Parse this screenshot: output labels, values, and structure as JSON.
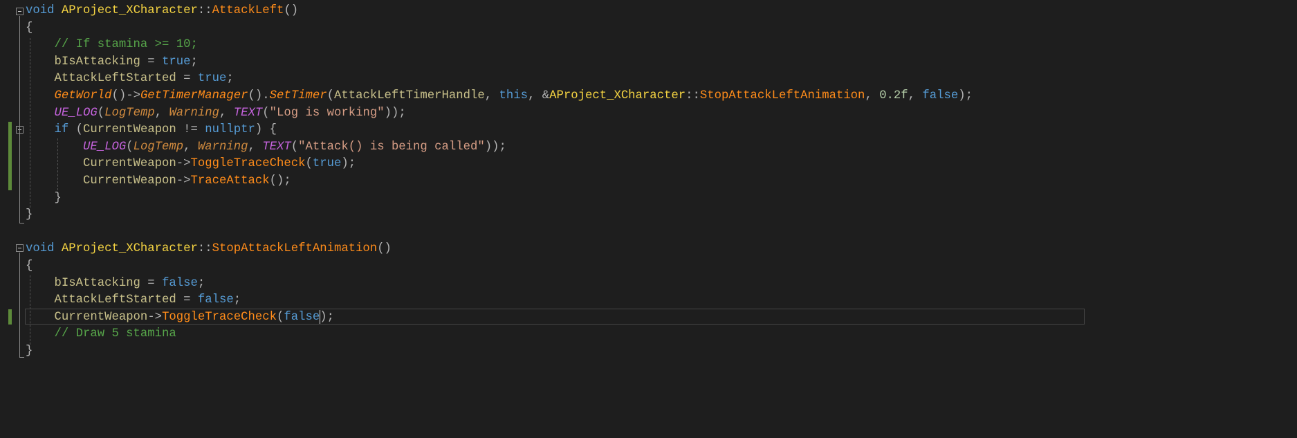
{
  "colors": {
    "background": "#1e1e1e",
    "keyword": "#569cd6",
    "class": "#f5d442",
    "function": "#ff8c1a",
    "variable": "#c8c08a",
    "comment": "#57a64a",
    "macro": "#c563dd",
    "string": "#d69d85",
    "change_marker": "#5d8a3a"
  },
  "lines": [
    {
      "t": [
        [
          "void",
          "kw"
        ],
        [
          " ",
          "p"
        ],
        [
          "AProject_XCharacter",
          "cls"
        ],
        [
          "::",
          "p"
        ],
        [
          "AttackLeft",
          "fn"
        ],
        [
          "()",
          "p"
        ]
      ]
    },
    {
      "t": [
        [
          "{",
          "p"
        ]
      ]
    },
    {
      "t": [
        [
          "    // If stamina >= 10;",
          "cm"
        ]
      ]
    },
    {
      "t": [
        [
          "    ",
          "p"
        ],
        [
          "bIsAttacking",
          "var"
        ],
        [
          " = ",
          "p"
        ],
        [
          "true",
          "kw"
        ],
        [
          ";",
          "p"
        ]
      ]
    },
    {
      "t": [
        [
          "    ",
          "p"
        ],
        [
          "AttackLeftStarted",
          "var"
        ],
        [
          " = ",
          "p"
        ],
        [
          "true",
          "kw"
        ],
        [
          ";",
          "p"
        ]
      ]
    },
    {
      "t": [
        [
          "    ",
          "p"
        ],
        [
          "GetWorld",
          "fni"
        ],
        [
          "()->",
          "p"
        ],
        [
          "GetTimerManager",
          "fni"
        ],
        [
          "().",
          "p"
        ],
        [
          "SetTimer",
          "fni"
        ],
        [
          "(",
          "p"
        ],
        [
          "AttackLeftTimerHandle",
          "var"
        ],
        [
          ", ",
          "p"
        ],
        [
          "this",
          "kw"
        ],
        [
          ", &",
          "p"
        ],
        [
          "AProject_XCharacter",
          "cls"
        ],
        [
          "::",
          "p"
        ],
        [
          "StopAttackLeftAnimation",
          "fn"
        ],
        [
          ", ",
          "p"
        ],
        [
          "0.2f",
          "num"
        ],
        [
          ", ",
          "p"
        ],
        [
          "false",
          "kw"
        ],
        [
          ");",
          "p"
        ]
      ]
    },
    {
      "t": [
        [
          "    ",
          "p"
        ],
        [
          "UE_LOG",
          "mac"
        ],
        [
          "(",
          "p"
        ],
        [
          "LogTemp",
          "mi"
        ],
        [
          ", ",
          "p"
        ],
        [
          "Warning",
          "mi"
        ],
        [
          ", ",
          "p"
        ],
        [
          "TEXT",
          "mac"
        ],
        [
          "(",
          "p"
        ],
        [
          "\"Log is working\"",
          "str"
        ],
        [
          "));",
          "p"
        ]
      ]
    },
    {
      "t": [
        [
          "    ",
          "p"
        ],
        [
          "if",
          "kw"
        ],
        [
          " (",
          "p"
        ],
        [
          "CurrentWeapon",
          "var"
        ],
        [
          " != ",
          "p"
        ],
        [
          "nullptr",
          "kw"
        ],
        [
          ") {",
          "p"
        ]
      ]
    },
    {
      "t": [
        [
          "        ",
          "p"
        ],
        [
          "UE_LOG",
          "mac"
        ],
        [
          "(",
          "p"
        ],
        [
          "LogTemp",
          "mi"
        ],
        [
          ", ",
          "p"
        ],
        [
          "Warning",
          "mi"
        ],
        [
          ", ",
          "p"
        ],
        [
          "TEXT",
          "mac"
        ],
        [
          "(",
          "p"
        ],
        [
          "\"Attack() is being called\"",
          "str"
        ],
        [
          "));",
          "p"
        ]
      ]
    },
    {
      "t": [
        [
          "        ",
          "p"
        ],
        [
          "CurrentWeapon",
          "var"
        ],
        [
          "->",
          "p"
        ],
        [
          "ToggleTraceCheck",
          "fn"
        ],
        [
          "(",
          "p"
        ],
        [
          "true",
          "kw"
        ],
        [
          ");",
          "p"
        ]
      ]
    },
    {
      "t": [
        [
          "        ",
          "p"
        ],
        [
          "CurrentWeapon",
          "var"
        ],
        [
          "->",
          "p"
        ],
        [
          "TraceAttack",
          "fn"
        ],
        [
          "();",
          "p"
        ]
      ]
    },
    {
      "t": [
        [
          "    }",
          "p"
        ]
      ]
    },
    {
      "t": [
        [
          "}",
          "p"
        ]
      ]
    },
    {
      "t": []
    },
    {
      "t": [
        [
          "void",
          "kw"
        ],
        [
          " ",
          "p"
        ],
        [
          "AProject_XCharacter",
          "cls"
        ],
        [
          "::",
          "p"
        ],
        [
          "StopAttackLeftAnimation",
          "fn"
        ],
        [
          "()",
          "p"
        ]
      ]
    },
    {
      "t": [
        [
          "{",
          "p"
        ]
      ]
    },
    {
      "t": [
        [
          "    ",
          "p"
        ],
        [
          "bIsAttacking",
          "var"
        ],
        [
          " = ",
          "p"
        ],
        [
          "false",
          "kw"
        ],
        [
          ";",
          "p"
        ]
      ]
    },
    {
      "t": [
        [
          "    ",
          "p"
        ],
        [
          "AttackLeftStarted",
          "var"
        ],
        [
          " = ",
          "p"
        ],
        [
          "false",
          "kw"
        ],
        [
          ";",
          "p"
        ]
      ]
    },
    {
      "t": [
        [
          "    ",
          "p"
        ],
        [
          "CurrentWeapon",
          "var"
        ],
        [
          "->",
          "p"
        ],
        [
          "ToggleTraceCheck",
          "fn"
        ],
        [
          "(",
          "p"
        ],
        [
          "false",
          "kw"
        ],
        [
          ");",
          "p"
        ]
      ]
    },
    {
      "t": [
        [
          "    // Draw 5 stamina",
          "cm"
        ]
      ]
    },
    {
      "t": [
        [
          "}",
          "p"
        ]
      ]
    }
  ]
}
